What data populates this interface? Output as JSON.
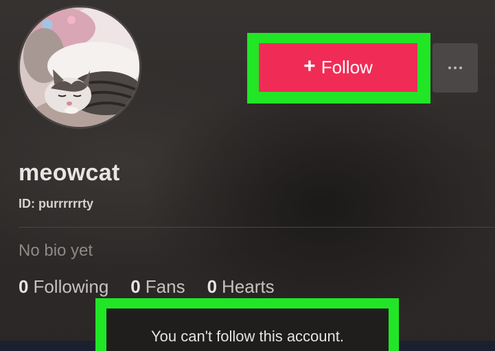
{
  "profile": {
    "username": "meowcat",
    "id_text": "ID: purrrrrrty",
    "bio": "No bio yet",
    "avatar_icon": "cat-photo-avatar"
  },
  "actions": {
    "follow_label": "Follow",
    "follow_icon": "plus-icon",
    "more_icon": "more-dots-icon",
    "follow_color": "#f02c56",
    "highlight_color": "#21e626"
  },
  "stats": [
    {
      "count": "0",
      "label": "Following"
    },
    {
      "count": "0",
      "label": "Fans"
    },
    {
      "count": "0",
      "label": "Hearts"
    }
  ],
  "toast": {
    "message": "You can't follow this account."
  }
}
